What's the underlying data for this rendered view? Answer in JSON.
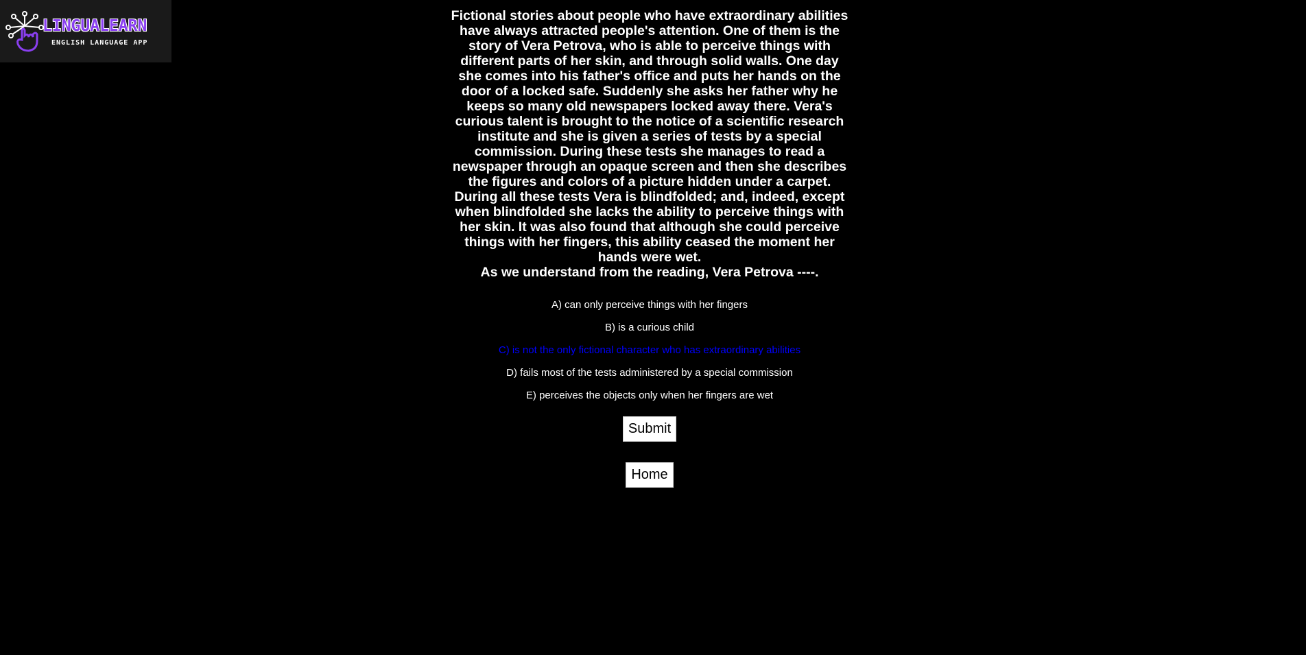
{
  "logo": {
    "title": "LINGUALEARN",
    "subtitle": "ENGLISH LANGUAGE APP"
  },
  "passage": "Fictional stories about people who have extraordinary abilities have always attracted people's attention. One of them is the story of Vera Petrova, who is able to perceive things with different parts of her skin, and through solid walls. One day she comes into his father's office and puts her hands on the door of a locked safe. Suddenly she asks her father why he keeps so many old newspapers locked away there. Vera's curious talent is brought to the notice of a scientific research institute and she is given a series of tests by a special commission. During these tests she manages to read a newspaper through an opaque screen and then she describes the figures and colors of a picture hidden under a carpet. During all these tests Vera is blindfolded; and, indeed, except when blindfolded she lacks the ability to perceive things with her skin. It was also found that although she could perceive things with her fingers, this ability ceased the moment her hands were wet.",
  "question": "As we understand from the reading, Vera Petrova ----.",
  "options": [
    {
      "label": "A) can only perceive things with her fingers",
      "selected": false
    },
    {
      "label": "B) is a curious child",
      "selected": false
    },
    {
      "label": "C) is not the only fictional character who has extraordinary abilities",
      "selected": true
    },
    {
      "label": "D) fails most of the tests administered by a special commission",
      "selected": false
    },
    {
      "label": "E) perceives the objects only when her fingers are wet",
      "selected": false
    }
  ],
  "buttons": {
    "submit": "Submit",
    "home": "Home"
  },
  "colors": {
    "background": "#000000",
    "text": "#ffffff",
    "selected_option": "#0000ff",
    "brand": "#8a3ff0"
  },
  "icons": {
    "logo": "circuit-hand-icon"
  }
}
